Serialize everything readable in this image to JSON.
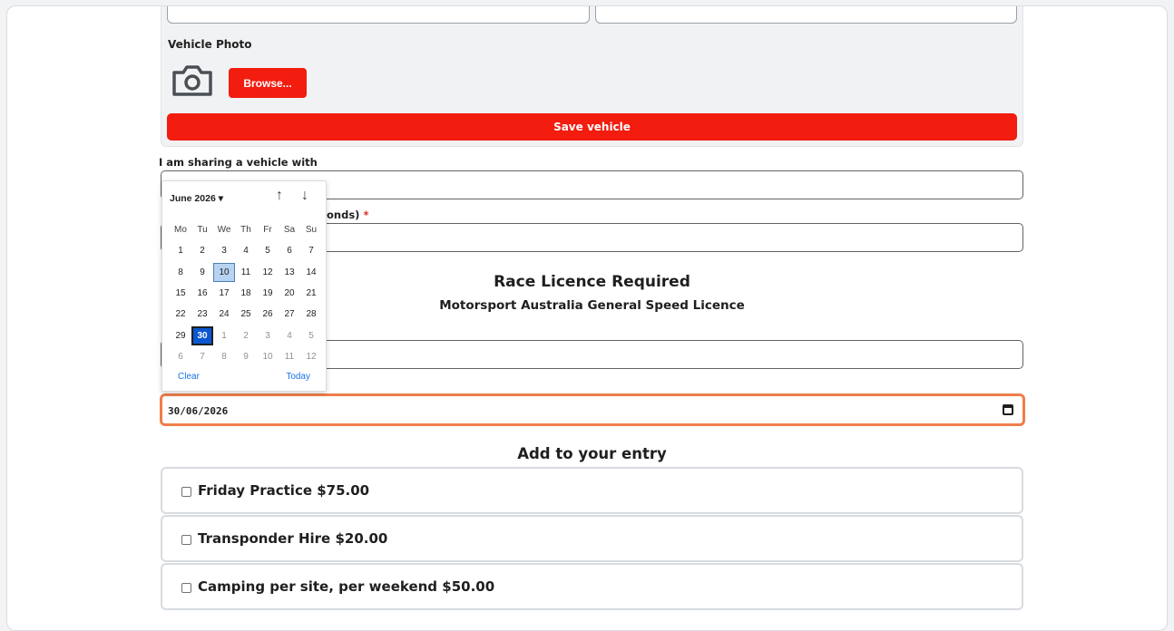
{
  "vehicle": {
    "photo_label": "Vehicle Photo",
    "browse_label": "Browse...",
    "save_label": "Save vehicle"
  },
  "sharing": {
    "label": "I am sharing a vehicle with"
  },
  "hidden_label": {
    "visible_fragment": "onds)",
    "required_mark": "*"
  },
  "licence": {
    "title": "Race Licence Required",
    "subtitle": "Motorsport Australia General Speed Licence"
  },
  "date": {
    "value": "30/06/2026"
  },
  "calendar": {
    "month_label": "June 2026 ▾",
    "up_arrow": "↑",
    "down_arrow": "↓",
    "weekdays": [
      "Mo",
      "Tu",
      "We",
      "Th",
      "Fr",
      "Sa",
      "Su"
    ],
    "weeks": [
      [
        "1",
        "2",
        "3",
        "4",
        "5",
        "6",
        "7"
      ],
      [
        "8",
        "9",
        "10",
        "11",
        "12",
        "13",
        "14"
      ],
      [
        "15",
        "16",
        "17",
        "18",
        "19",
        "20",
        "21"
      ],
      [
        "22",
        "23",
        "24",
        "25",
        "26",
        "27",
        "28"
      ],
      [
        "29",
        "30",
        "1",
        "2",
        "3",
        "4",
        "5"
      ],
      [
        "6",
        "7",
        "8",
        "9",
        "10",
        "11",
        "12"
      ]
    ],
    "today_day": "10",
    "selected_day": "30",
    "clear_label": "Clear",
    "today_label": "Today"
  },
  "addons": {
    "heading": "Add to your entry",
    "items": [
      {
        "label": "Friday Practice $75.00",
        "checked": false
      },
      {
        "label": "Transponder Hire $20.00",
        "checked": false
      },
      {
        "label": "Camping per site, per weekend $50.00",
        "checked": false
      }
    ]
  },
  "colors": {
    "brand_red": "#f21c0f",
    "focus_orange": "#f07d4a",
    "selected_blue": "#0b57d0"
  }
}
